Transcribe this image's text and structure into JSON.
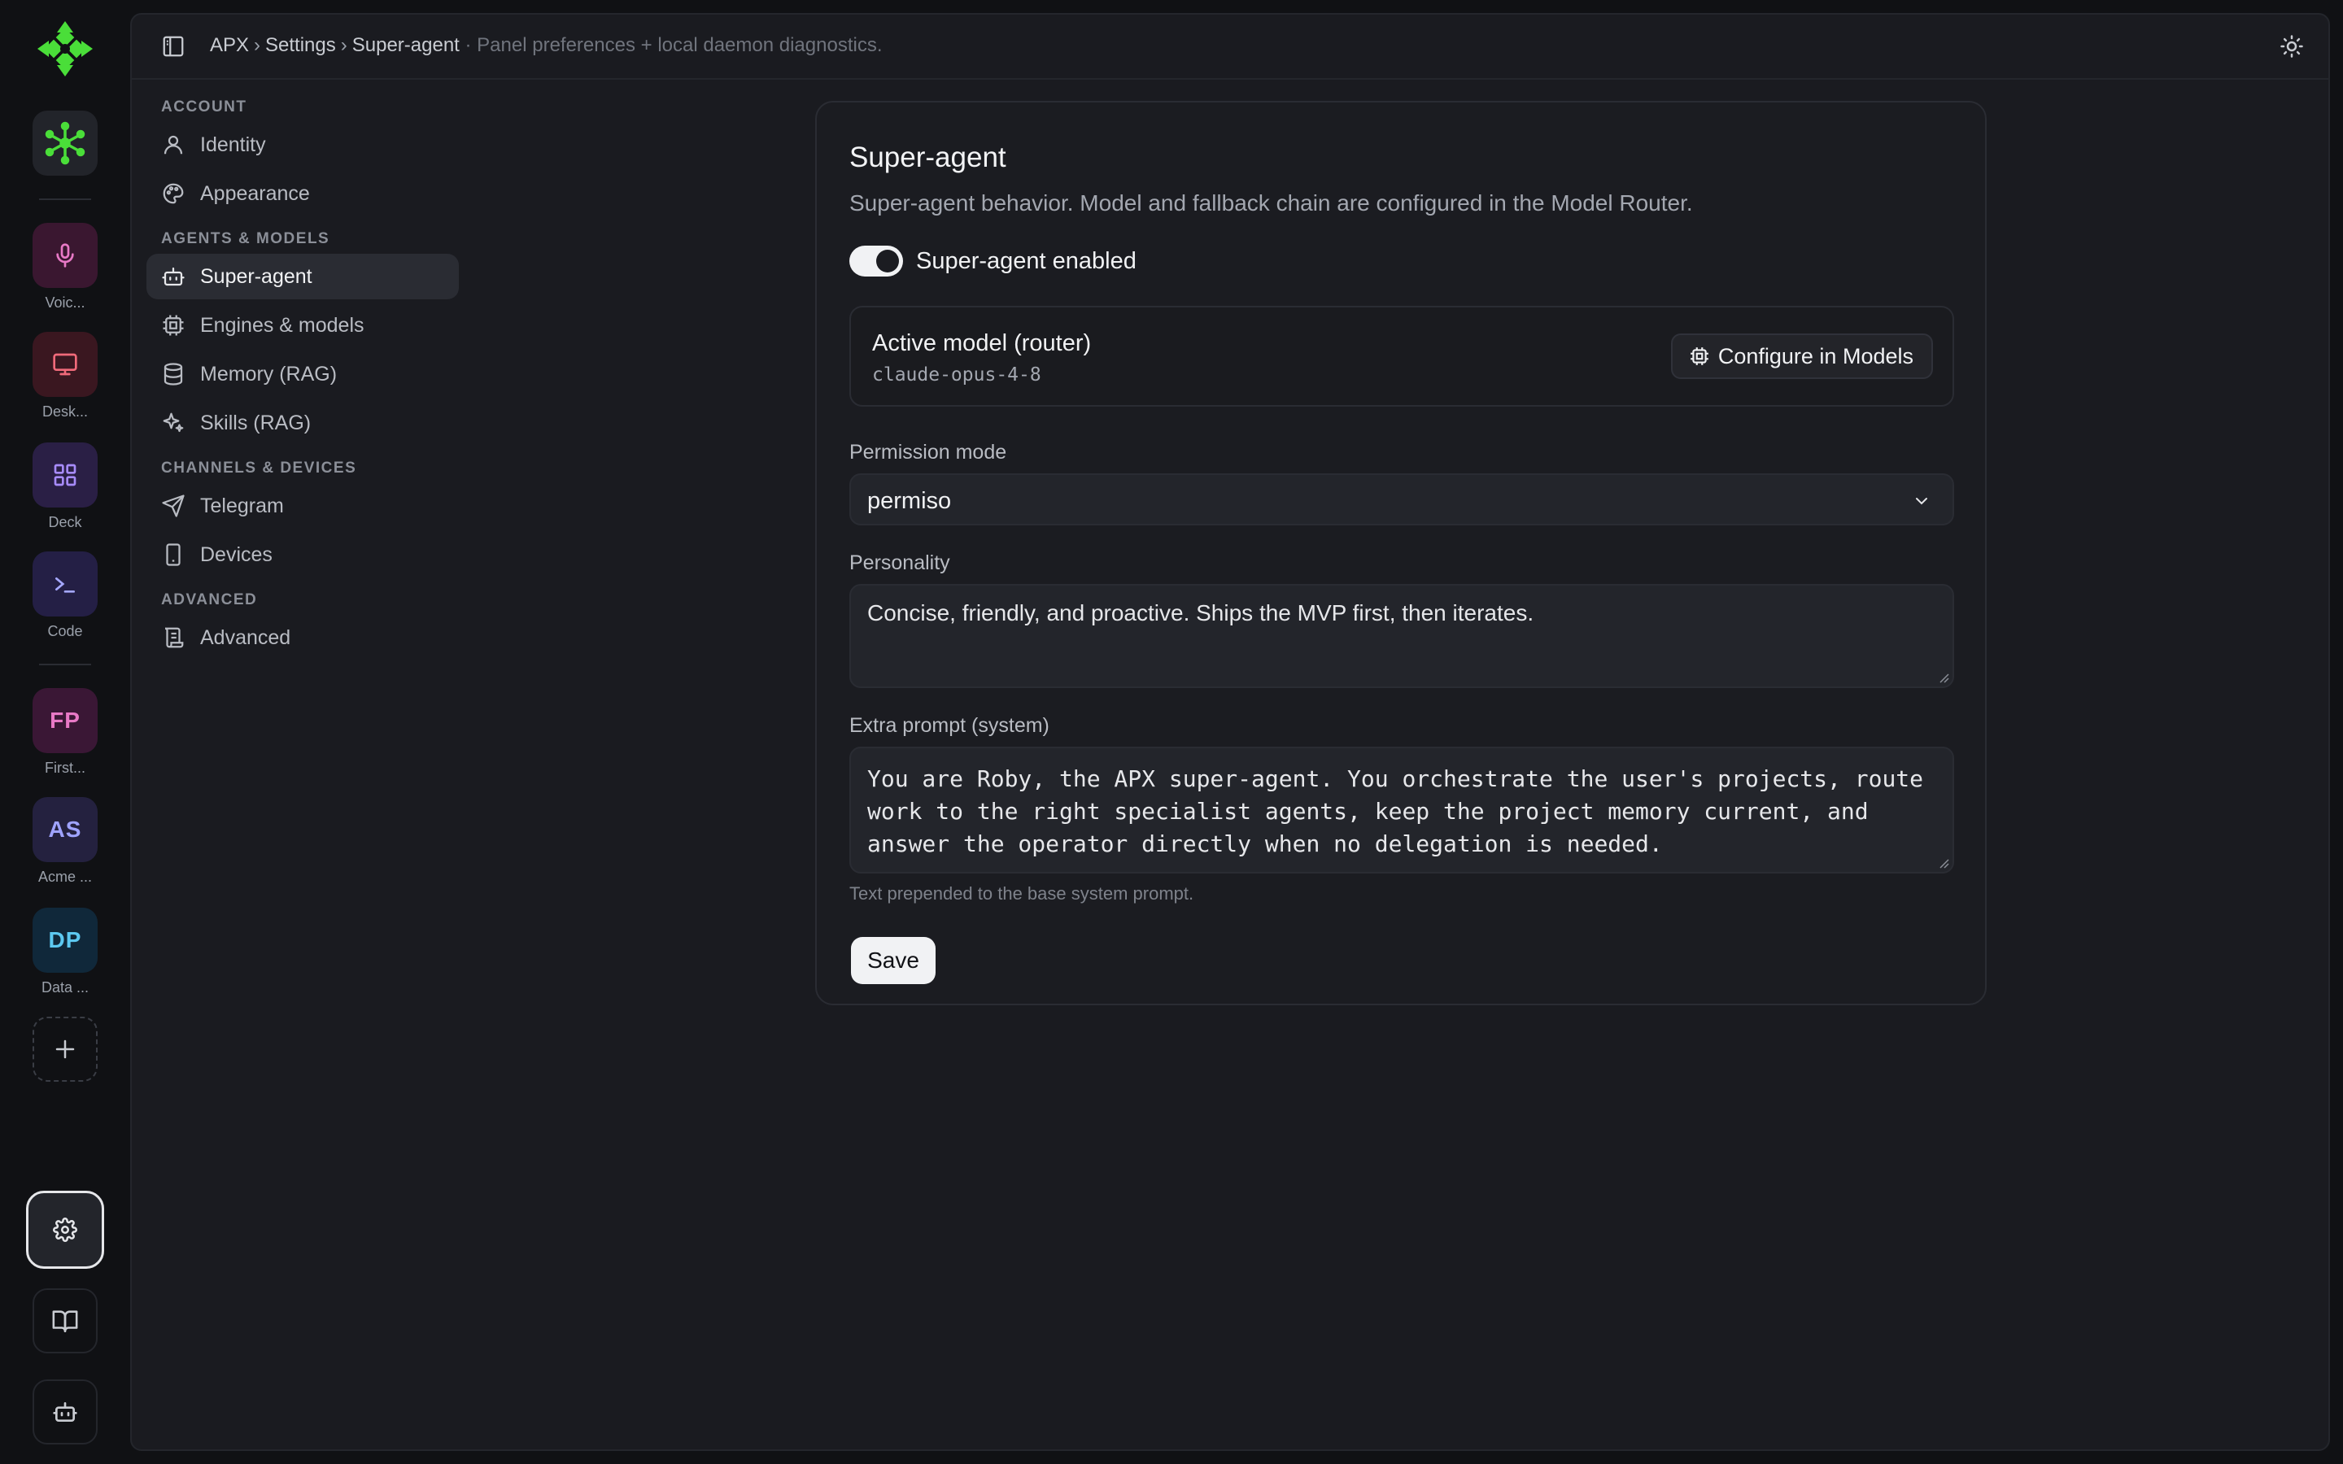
{
  "rail": {
    "items": [
      {
        "label": "Voic...",
        "icon": "mic-icon",
        "bg": "#3a1730",
        "fg": "#e879c6"
      },
      {
        "label": "Desk...",
        "icon": "monitor-icon",
        "bg": "#3a1720",
        "fg": "#f06a7a"
      },
      {
        "label": "Deck",
        "icon": "grid-icon",
        "bg": "#2a1f45",
        "fg": "#a78bfa"
      },
      {
        "label": "Code",
        "icon": "terminal-icon",
        "bg": "#241f45",
        "fg": "#a5a8ff"
      }
    ],
    "projects": [
      {
        "abbr": "FP",
        "label": "First...",
        "bg": "#3a1735",
        "fg": "#e879c6"
      },
      {
        "abbr": "AS",
        "label": "Acme ...",
        "bg": "#24213f",
        "fg": "#9fa3ff"
      },
      {
        "abbr": "DP",
        "label": "Data ...",
        "bg": "#10283a",
        "fg": "#5cc8f0"
      }
    ]
  },
  "breadcrumb": {
    "app": "APX",
    "sep": "›",
    "section": "Settings",
    "page": "Super-agent",
    "description": "· Panel preferences + local daemon diagnostics."
  },
  "nav": {
    "account_heading": "ACCOUNT",
    "identity": "Identity",
    "appearance": "Appearance",
    "agents_heading": "AGENTS & MODELS",
    "super_agent": "Super-agent",
    "engines": "Engines & models",
    "memory": "Memory (RAG)",
    "skills": "Skills (RAG)",
    "channels_heading": "CHANNELS & DEVICES",
    "telegram": "Telegram",
    "devices": "Devices",
    "advanced_heading": "ADVANCED",
    "advanced": "Advanced"
  },
  "card": {
    "title": "Super-agent",
    "subtitle": "Super-agent behavior. Model and fallback chain are configured in the Model Router.",
    "toggle_label": "Super-agent enabled",
    "toggle_on": true,
    "model_title": "Active model (router)",
    "model_id": "claude-opus-4-8",
    "configure_label": "Configure in Models",
    "permission_label": "Permission mode",
    "permission_value": "permiso",
    "personality_label": "Personality",
    "personality_value": "Concise, friendly, and proactive. Ships the MVP first, then iterates.",
    "extra_label": "Extra prompt (system)",
    "extra_value": "You are Roby, the APX super-agent. You orchestrate the user's projects, route work to the right specialist agents, keep the project memory current, and answer the operator directly when no delegation is needed.",
    "extra_hint": "Text prepended to the base system prompt.",
    "save_label": "Save"
  },
  "colors": {
    "accent_green": "#4ade39",
    "background": "#101114",
    "panel": "#1a1b20"
  }
}
